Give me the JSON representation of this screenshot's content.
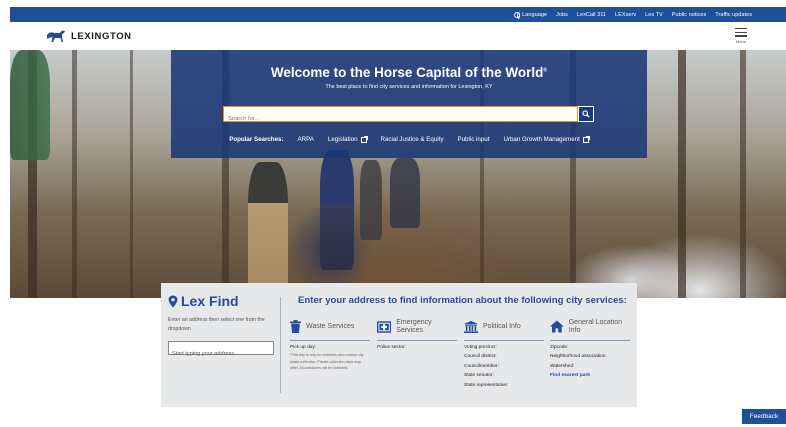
{
  "topbar": {
    "links": [
      "Language",
      "Jobs",
      "LexCall 311",
      "LEXserv",
      "Lex TV",
      "Public notices",
      "Traffic updates"
    ]
  },
  "header": {
    "logo_text": "LEXINGTON",
    "menu_label": "Menu"
  },
  "hero": {
    "title": "Welcome to the Horse Capital of the World",
    "title_mark": "®",
    "subtitle": "The best place to find city services and information for Lexington, KY",
    "search_placeholder": "Search for...",
    "popular_label": "Popular Searches:",
    "popular_links": [
      "ARPA",
      "Legislation",
      "Racial Justice & Equity",
      "Public input",
      "Urban Growth Management"
    ]
  },
  "lexfind": {
    "title": "Lex Find",
    "description": "Enter an address then select one from the dropdown",
    "input_placeholder": "Start typing your address...",
    "heading": "Enter your address to find information about the following city services:",
    "services": [
      {
        "name": "Waste Services",
        "icon": "trash-icon",
        "rows": [
          "Pick up day:"
        ],
        "note": "*This day is only for residents who receive city waste collection. Private collection days may differ. All containers will be collected."
      },
      {
        "name": "Emergency Services",
        "icon": "emergency-icon",
        "rows": [
          "Police sector:"
        ]
      },
      {
        "name": "Political Info",
        "icon": "government-building-icon",
        "rows": [
          "Voting precinct:",
          "Council district:",
          "Councilmember:",
          "State senator:",
          "State representative:"
        ]
      },
      {
        "name": "General Location Info",
        "icon": "home-icon",
        "rows": [
          "Zipcode:",
          "Neighborhood association:",
          "Watershed:"
        ],
        "link": "Find nearest park"
      }
    ]
  },
  "feedback_label": "Feedback",
  "colors": {
    "brand_blue": "#1f4e9b",
    "hero_panel": "#1a377a",
    "search_border": "#d8a200",
    "lexfind_bg": "#e7e8ea"
  }
}
